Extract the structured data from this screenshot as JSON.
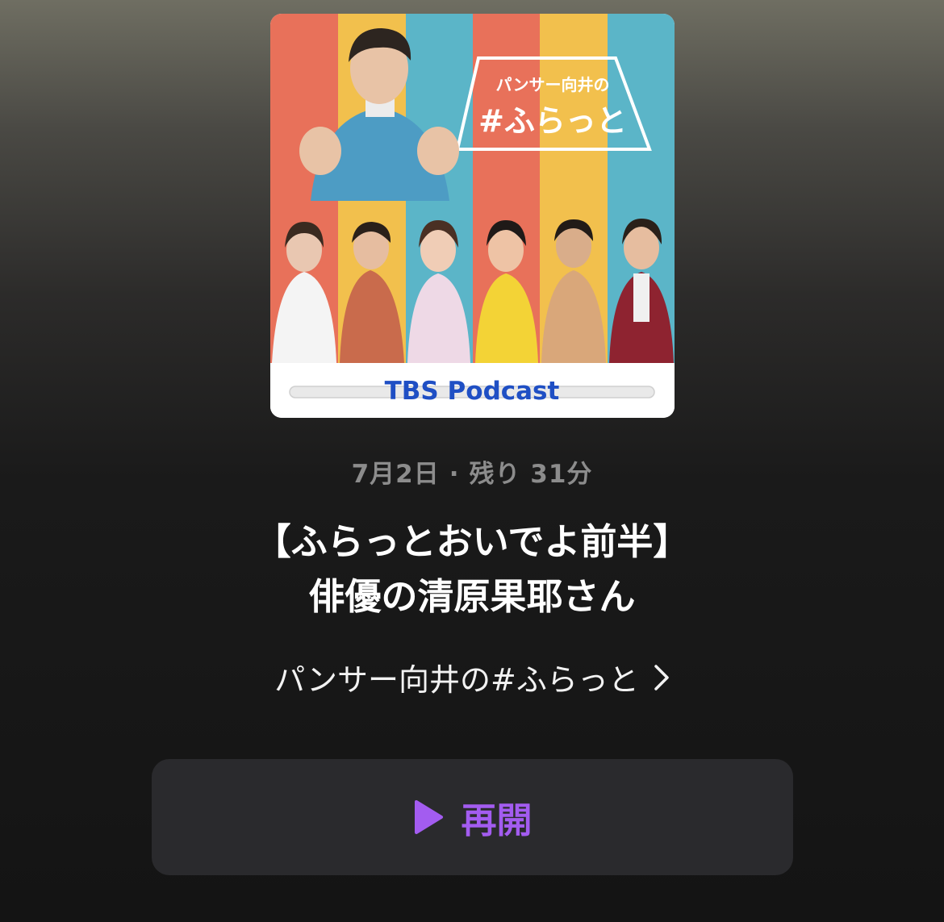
{
  "artwork": {
    "logo_line1": "パンサー向井の",
    "logo_line2": "#ふらっと",
    "brand": "TBS Podcast"
  },
  "episode": {
    "date": "7月2日",
    "separator": "·",
    "remaining": "残り 31分",
    "title_line1": "【ふらっとおいでよ前半】",
    "title_line2": "俳優の清原果耶さん"
  },
  "show": {
    "name": "パンサー向井の#ふらっと",
    "chevron_icon": "chevron-right-icon"
  },
  "action": {
    "resume_label": "再開",
    "icon": "play-icon"
  },
  "colors": {
    "accent": "#a35cf0",
    "button_bg": "#2a2a2d",
    "stripe_red": "#e8715a",
    "stripe_yellow": "#f2c04d",
    "stripe_teal": "#5bb5c8",
    "brand_blue": "#1f4fc4"
  }
}
